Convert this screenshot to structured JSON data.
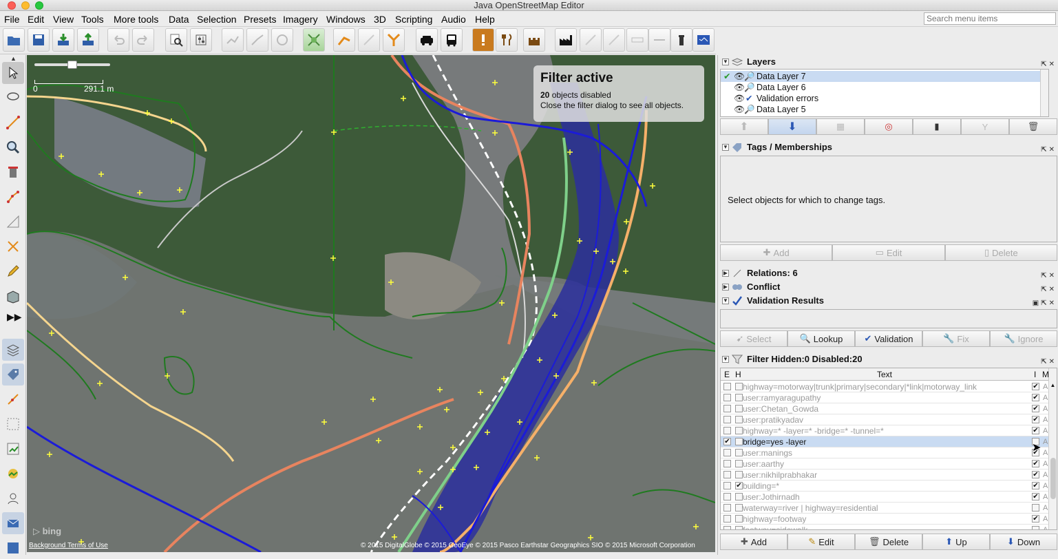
{
  "window": {
    "title": "Java OpenStreetMap Editor"
  },
  "menubar": {
    "items": [
      "File",
      "Edit",
      "View",
      "Tools",
      "More tools",
      "Data",
      "Selection",
      "Presets",
      "Imagery",
      "Windows",
      "3D",
      "Scripting",
      "Audio",
      "Help"
    ],
    "search_placeholder": "Search menu items"
  },
  "map": {
    "scale_start": "0",
    "scale_end": "291.1 m",
    "filter_title": "Filter active",
    "filter_count": "20",
    "filter_count_suffix": " objects disabled",
    "filter_hint": "Close the filter dialog to see all objects.",
    "attribution_left": "Background Terms of Use",
    "attribution_right": "© 2015 DigitalGlobe © 2015 GeoEye © 2015 Pasco Earthstar Geographics  SIO © 2015 Microsoft Corporation"
  },
  "layers_panel": {
    "title": "Layers",
    "layers": [
      "Data Layer 7",
      "Data Layer 6",
      "Validation errors",
      "Data Layer 5"
    ]
  },
  "tags_panel": {
    "title": "Tags / Memberships",
    "empty_text": "Select objects for which to change tags.",
    "add": "Add",
    "edit": "Edit",
    "delete": "Delete"
  },
  "relations_panel": {
    "title": "Relations: 6"
  },
  "conflict_panel": {
    "title": "Conflict"
  },
  "validation_panel": {
    "title": "Validation Results",
    "select": "Select",
    "lookup": "Lookup",
    "validation": "Validation",
    "fix": "Fix",
    "ignore": "Ignore"
  },
  "filter_panel": {
    "title": "Filter Hidden:0 Disabled:20",
    "col_e": "E",
    "col_h": "H",
    "col_text": "Text",
    "col_i": "I",
    "col_m": "M",
    "rows": [
      {
        "text": "highway=motorway|trunk|primary|secondary|*link|motorway_link",
        "e": false,
        "h": false,
        "i": true,
        "m": "A"
      },
      {
        "text": "user:ramyaragupathy",
        "e": false,
        "h": false,
        "i": true,
        "m": "A"
      },
      {
        "text": "user:Chetan_Gowda",
        "e": false,
        "h": false,
        "i": true,
        "m": "A"
      },
      {
        "text": "user:pratikyadav",
        "e": false,
        "h": false,
        "i": true,
        "m": "A"
      },
      {
        "text": "highway=* -layer=* -bridge=* -tunnel=*",
        "e": false,
        "h": false,
        "i": true,
        "m": "A"
      },
      {
        "text": "bridge=yes -layer",
        "e": true,
        "h": false,
        "i": false,
        "m": "A"
      },
      {
        "text": "user:manings",
        "e": false,
        "h": false,
        "i": true,
        "m": "A"
      },
      {
        "text": "user:aarthy",
        "e": false,
        "h": false,
        "i": true,
        "m": "A"
      },
      {
        "text": "user:nikhilprabhakar",
        "e": false,
        "h": false,
        "i": true,
        "m": "A"
      },
      {
        "text": "building=*",
        "e": false,
        "h": true,
        "i": true,
        "m": "A"
      },
      {
        "text": "user:Jothirnadh",
        "e": false,
        "h": false,
        "i": true,
        "m": "A"
      },
      {
        "text": "waterway=river | highway=residential",
        "e": false,
        "h": false,
        "i": false,
        "m": "A"
      },
      {
        "text": "highway=footway",
        "e": false,
        "h": false,
        "i": true,
        "m": "A"
      },
      {
        "text": "footway=sidewalk",
        "e": false,
        "h": false,
        "i": false,
        "m": "A"
      }
    ],
    "add": "Add",
    "edit": "Edit",
    "delete": "Delete",
    "up": "Up",
    "down": "Down"
  },
  "colors": {
    "water": "#2b2f9c",
    "road_primary": "#e8845f",
    "road_secondary": "#f5c77e",
    "landuse": "#1f6b1f",
    "selection": "#c9dbf2"
  }
}
